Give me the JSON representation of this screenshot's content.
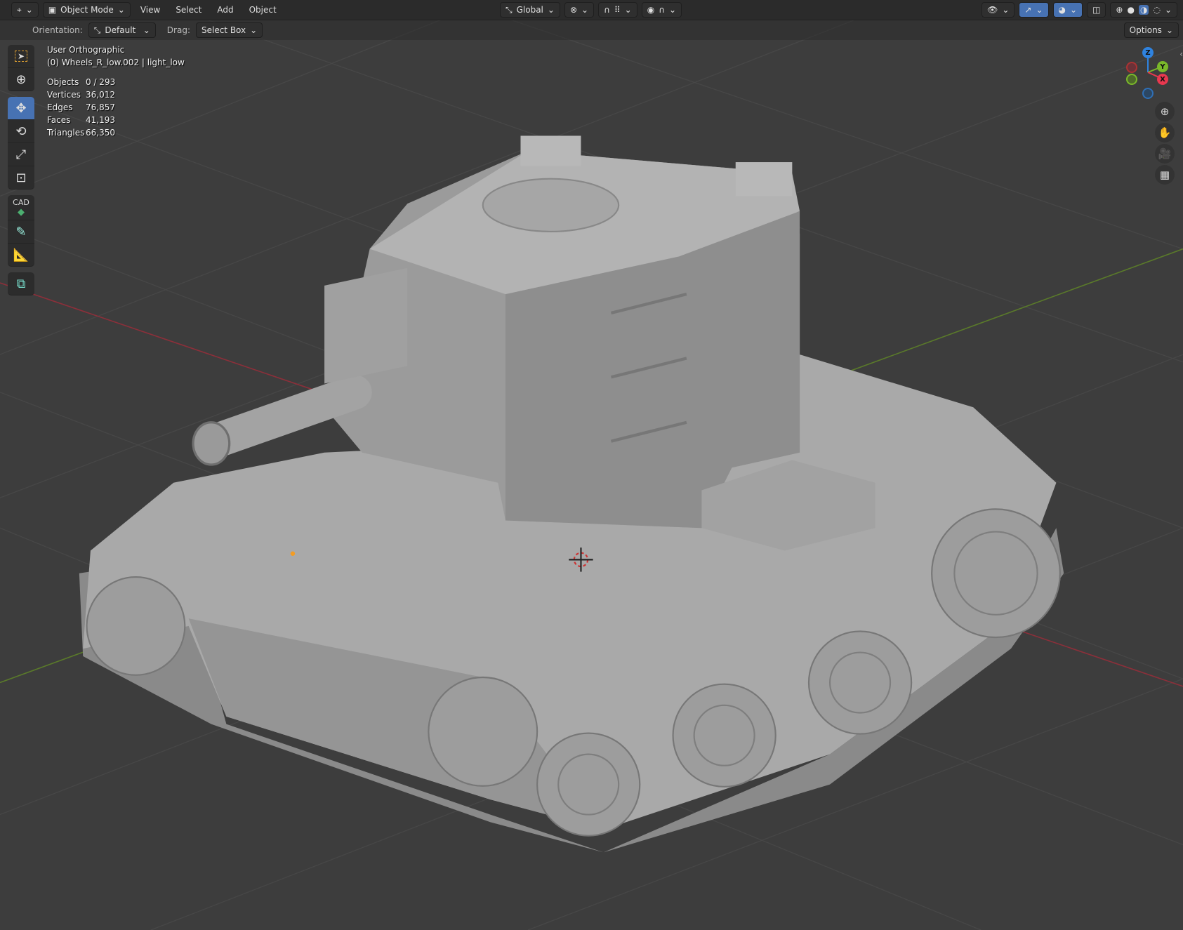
{
  "header": {
    "mode": "Object Mode",
    "menus": [
      "View",
      "Select",
      "Add",
      "Object"
    ],
    "transform_orientation": "Global"
  },
  "tool_header": {
    "orientation_label": "Orientation:",
    "orientation_value": "Default",
    "drag_label": "Drag:",
    "drag_value": "Select Box",
    "options": "Options"
  },
  "toolbar": {
    "cad_label": "CAD"
  },
  "overlay": {
    "view_name": "User Orthographic",
    "active": "(0) Wheels_R_low.002 | light_low",
    "stats": [
      {
        "label": "Objects",
        "value": "0 / 293"
      },
      {
        "label": "Vertices",
        "value": "36,012"
      },
      {
        "label": "Edges",
        "value": "76,857"
      },
      {
        "label": "Faces",
        "value": "41,193"
      },
      {
        "label": "Triangles",
        "value": "66,350"
      }
    ]
  },
  "gizmo": {
    "x": "X",
    "y": "Y",
    "z": "Z"
  },
  "colors": {
    "accent": "#4772b3",
    "x_axis": "#e8384f",
    "y_axis": "#7ab82a",
    "z_axis": "#2f83e0"
  }
}
